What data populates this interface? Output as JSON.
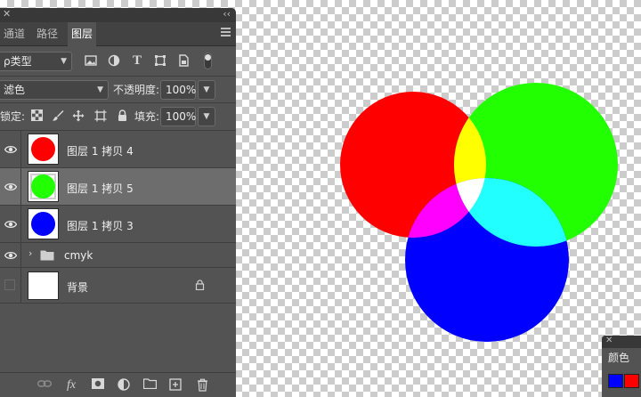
{
  "tabs": [
    {
      "label": "通道",
      "active": false
    },
    {
      "label": "路径",
      "active": false
    },
    {
      "label": "图层",
      "active": true
    }
  ],
  "filter": {
    "label": "ρ类型"
  },
  "blend_mode": "滤色",
  "opacity": {
    "label": "不透明度:",
    "value": "100%"
  },
  "lock": {
    "label": "锁定:"
  },
  "fill": {
    "label": "填充:",
    "value": "100%"
  },
  "layers": [
    {
      "name": "图层 1 拷贝 4",
      "color": "#ff0000",
      "visible": true,
      "selected": false
    },
    {
      "name": "图层 1 拷贝 5",
      "color": "#22ff00",
      "visible": true,
      "selected": true
    },
    {
      "name": "图层 1 拷贝 3",
      "color": "#0000ff",
      "visible": true,
      "selected": false
    },
    {
      "name": "cmyk",
      "type": "group",
      "visible": true
    },
    {
      "name": "背景",
      "color": "#ffffff",
      "visible": false,
      "locked": true
    }
  ],
  "color_panel": {
    "title": "颜色",
    "foreground": "#0000ff",
    "background": "#ff0000"
  },
  "canvas": {
    "colors": {
      "red": "#ff0000",
      "green": "#22ff00",
      "blue": "#0000ff",
      "yellow": "#ffff00",
      "magenta": "#ff00ff",
      "cyan": "#22ffff",
      "white": "#ffffff"
    }
  },
  "icons": {
    "filter_icons": [
      "image-icon",
      "adjustment-icon",
      "type-icon",
      "shape-icon",
      "smart-object-icon",
      "filter-toggle-icon"
    ],
    "lock_icons": [
      "lock-pixels-icon",
      "lock-brush-icon",
      "lock-position-icon",
      "lock-artboard-icon",
      "lock-all-icon"
    ],
    "bottom_icons": [
      "link-icon",
      "fx-icon",
      "mask-icon",
      "adjustment-layer-icon",
      "folder-icon",
      "new-layer-icon",
      "trash-icon"
    ]
  }
}
